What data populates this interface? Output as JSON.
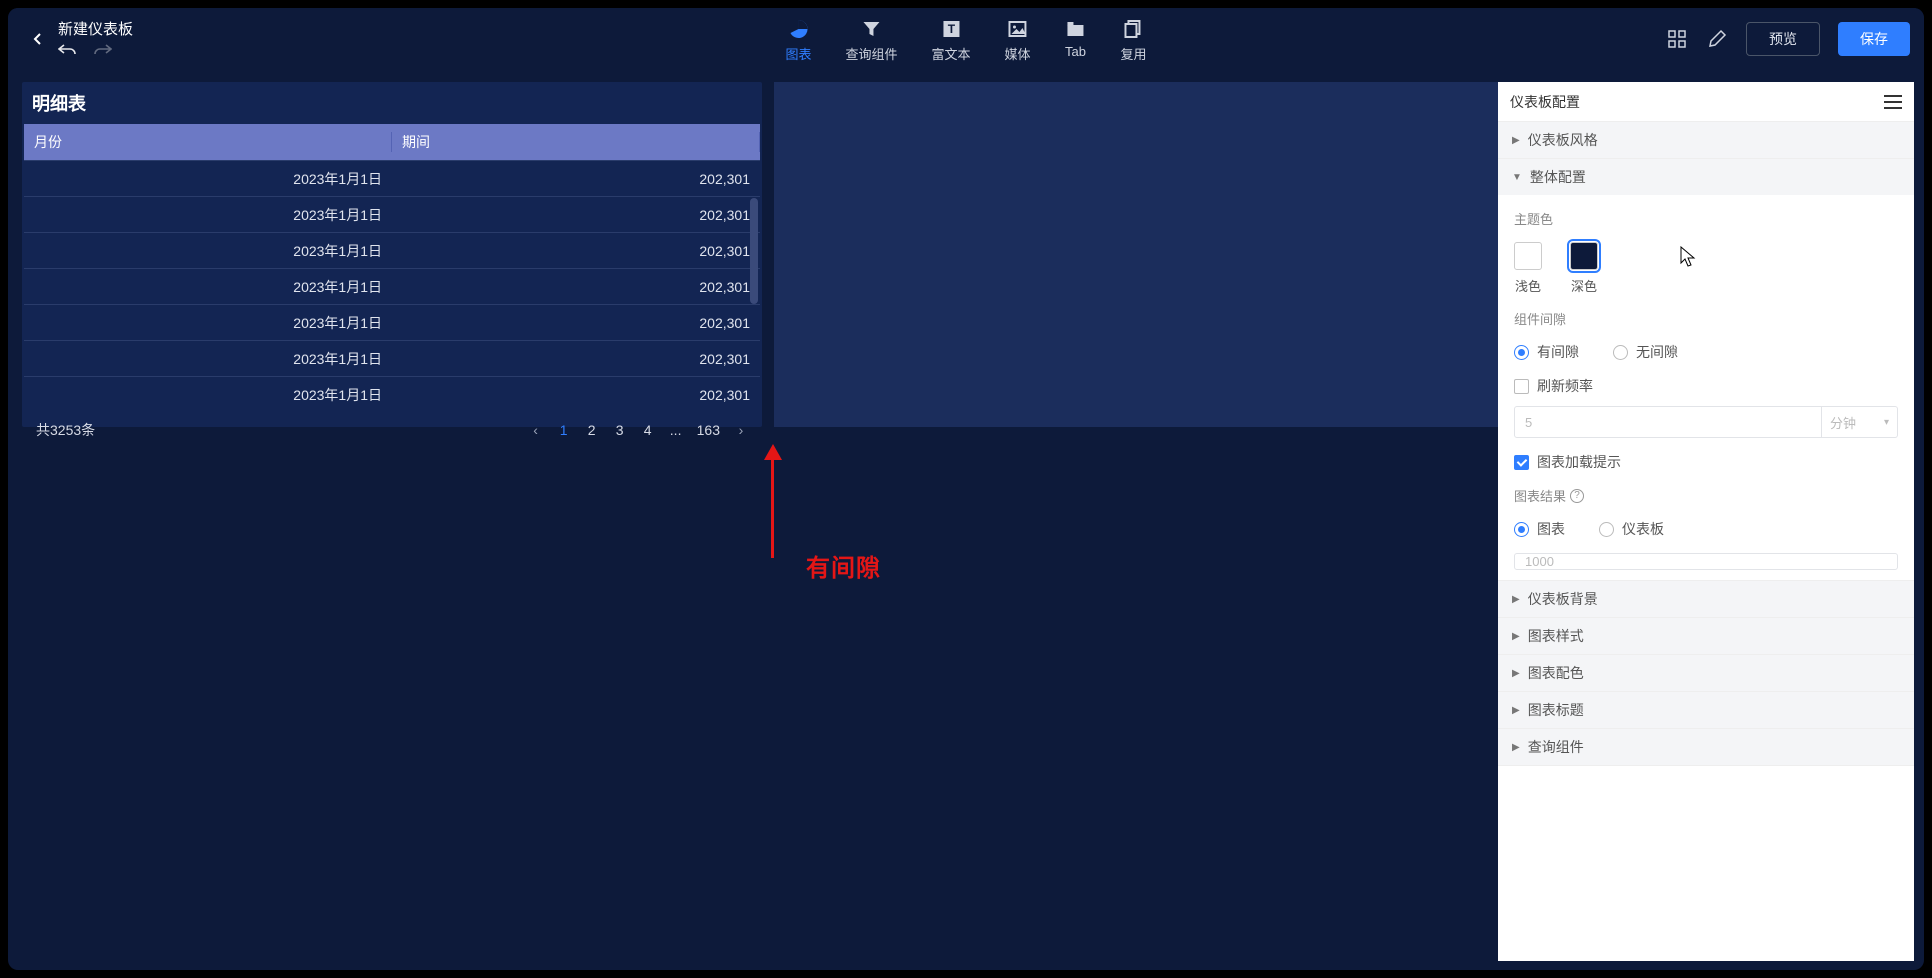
{
  "header": {
    "title": "新建仪表板",
    "tools": [
      {
        "key": "chart",
        "label": "图表",
        "active": true
      },
      {
        "key": "filter",
        "label": "查询组件"
      },
      {
        "key": "text",
        "label": "富文本"
      },
      {
        "key": "media",
        "label": "媒体"
      },
      {
        "key": "tab",
        "label": "Tab"
      },
      {
        "key": "reuse",
        "label": "复用"
      }
    ],
    "preview": "预览",
    "save": "保存"
  },
  "table": {
    "title": "明细表",
    "columns": [
      "月份",
      "期间"
    ],
    "rows": [
      {
        "c0": "2023年1月1日",
        "c1": "202,301"
      },
      {
        "c0": "2023年1月1日",
        "c1": "202,301"
      },
      {
        "c0": "2023年1月1日",
        "c1": "202,301"
      },
      {
        "c0": "2023年1月1日",
        "c1": "202,301"
      },
      {
        "c0": "2023年1月1日",
        "c1": "202,301"
      },
      {
        "c0": "2023年1月1日",
        "c1": "202,301"
      },
      {
        "c0": "2023年1月1日",
        "c1": "202,301"
      }
    ],
    "total": "共3253条",
    "pages": [
      "1",
      "2",
      "3",
      "4",
      "...",
      "163"
    ]
  },
  "annotation": {
    "text": "有间隙"
  },
  "config": {
    "title": "仪表板配置",
    "sections": {
      "style": "仪表板风格",
      "overall": "整体配置",
      "background": "仪表板背景",
      "chartStyle": "图表样式",
      "chartColor": "图表配色",
      "chartTitle": "图表标题",
      "queryComp": "查询组件"
    },
    "themeLabel": "主题色",
    "themeLight": "浅色",
    "themeDark": "深色",
    "gapLabel": "组件间隙",
    "gapOn": "有间隙",
    "gapOff": "无间隙",
    "refreshLabel": "刷新频率",
    "refreshValue": "5",
    "refreshUnit": "分钟",
    "loadingLabel": "图表加载提示",
    "resultLabel": "图表结果",
    "resultChart": "图表",
    "resultDash": "仪表板",
    "resultValue": "1000"
  }
}
